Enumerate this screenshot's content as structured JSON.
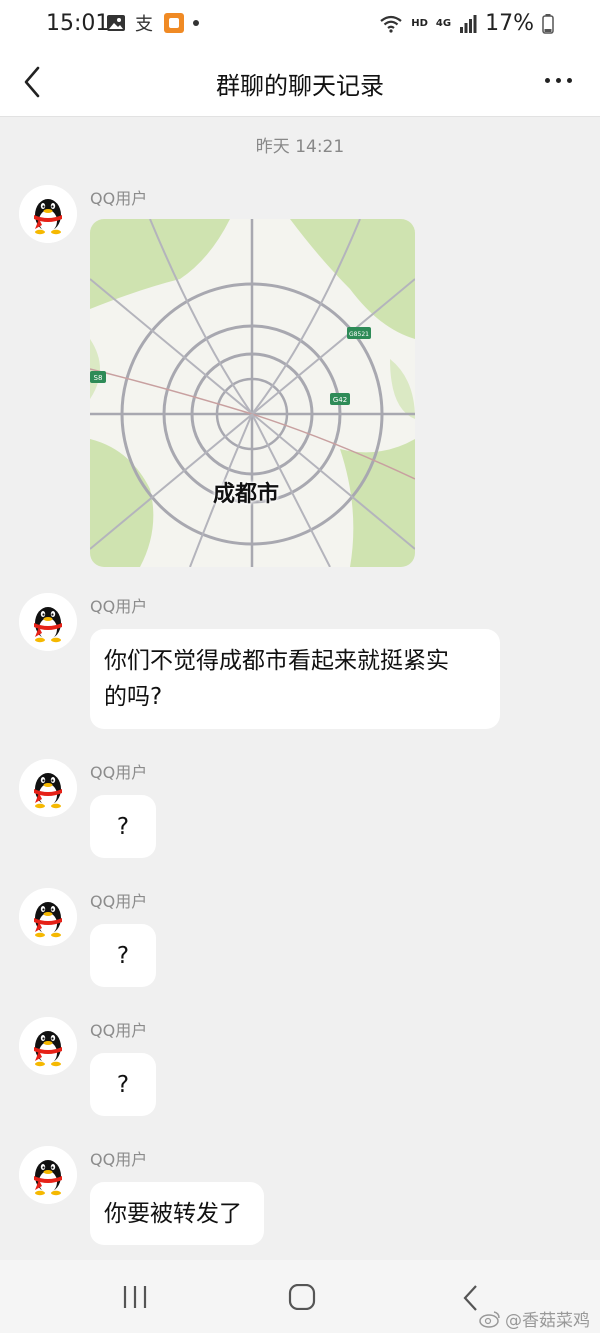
{
  "status_bar": {
    "time": "15:01",
    "network_hd": "HD",
    "network_4g": "4G",
    "battery": "17%"
  },
  "header": {
    "title": "群聊的聊天记录",
    "back_icon": "chevron-left-icon",
    "more_icon": "more-dots-icon"
  },
  "timestamp": "昨天 14:21",
  "messages": [
    {
      "sender": "QQ用户",
      "type": "image",
      "image_label": "成都市",
      "road_shields": [
        "S8",
        "G8521",
        "G42"
      ]
    },
    {
      "sender": "QQ用户",
      "type": "text",
      "lines": [
        "你们不觉得成都市看起来就挺紧实",
        "的吗?"
      ]
    },
    {
      "sender": "QQ用户",
      "type": "text",
      "lines": [
        "?"
      ]
    },
    {
      "sender": "QQ用户",
      "type": "text",
      "lines": [
        "?"
      ]
    },
    {
      "sender": "QQ用户",
      "type": "text",
      "lines": [
        "?"
      ]
    },
    {
      "sender": "QQ用户",
      "type": "text",
      "lines": [
        "你要被转发了"
      ]
    }
  ],
  "nav_bar": {
    "recent_icon": "recent-apps-icon",
    "home_icon": "home-icon",
    "back_icon": "back-icon"
  },
  "watermark": "@香菇菜鸡"
}
